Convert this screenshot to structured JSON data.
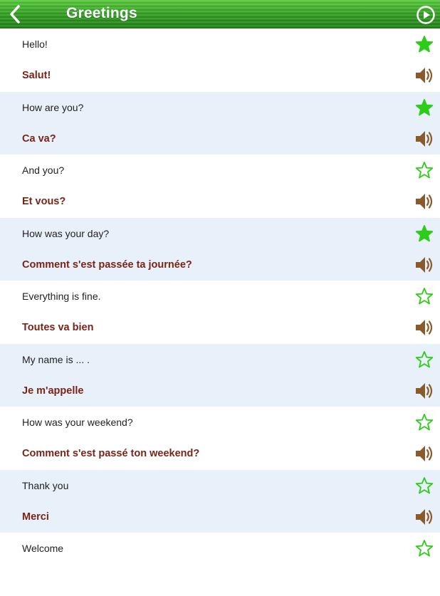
{
  "header": {
    "title": "Greetings",
    "back_icon": "chevron-left-icon",
    "play_icon": "play-circle-icon"
  },
  "colors": {
    "header_green": "#2f9a20",
    "french_text": "#7a2418",
    "star_green": "#2ecc1a",
    "speaker_brown": "#8b5a2b",
    "row_shade": "#e8f0f9"
  },
  "phrases": [
    {
      "english": "Hello!",
      "french": "Salut!",
      "favorite": true
    },
    {
      "english": "How are you?",
      "french": "Ca va?",
      "favorite": true
    },
    {
      "english": "And you?",
      "french": "Et vous?",
      "favorite": false
    },
    {
      "english": "How was your day?",
      "french": "Comment s'est passée ta journée?",
      "favorite": true
    },
    {
      "english": "Everything is fine.",
      "french": "Toutes va bien",
      "favorite": false
    },
    {
      "english": "My name is ... .",
      "french": "Je m'appelle",
      "favorite": false
    },
    {
      "english": "How was your weekend?",
      "french": "Comment s'est passé ton weekend?",
      "favorite": false
    },
    {
      "english": "Thank you",
      "french": "Merci",
      "favorite": false
    },
    {
      "english": "Welcome",
      "french": "",
      "favorite": false
    }
  ]
}
